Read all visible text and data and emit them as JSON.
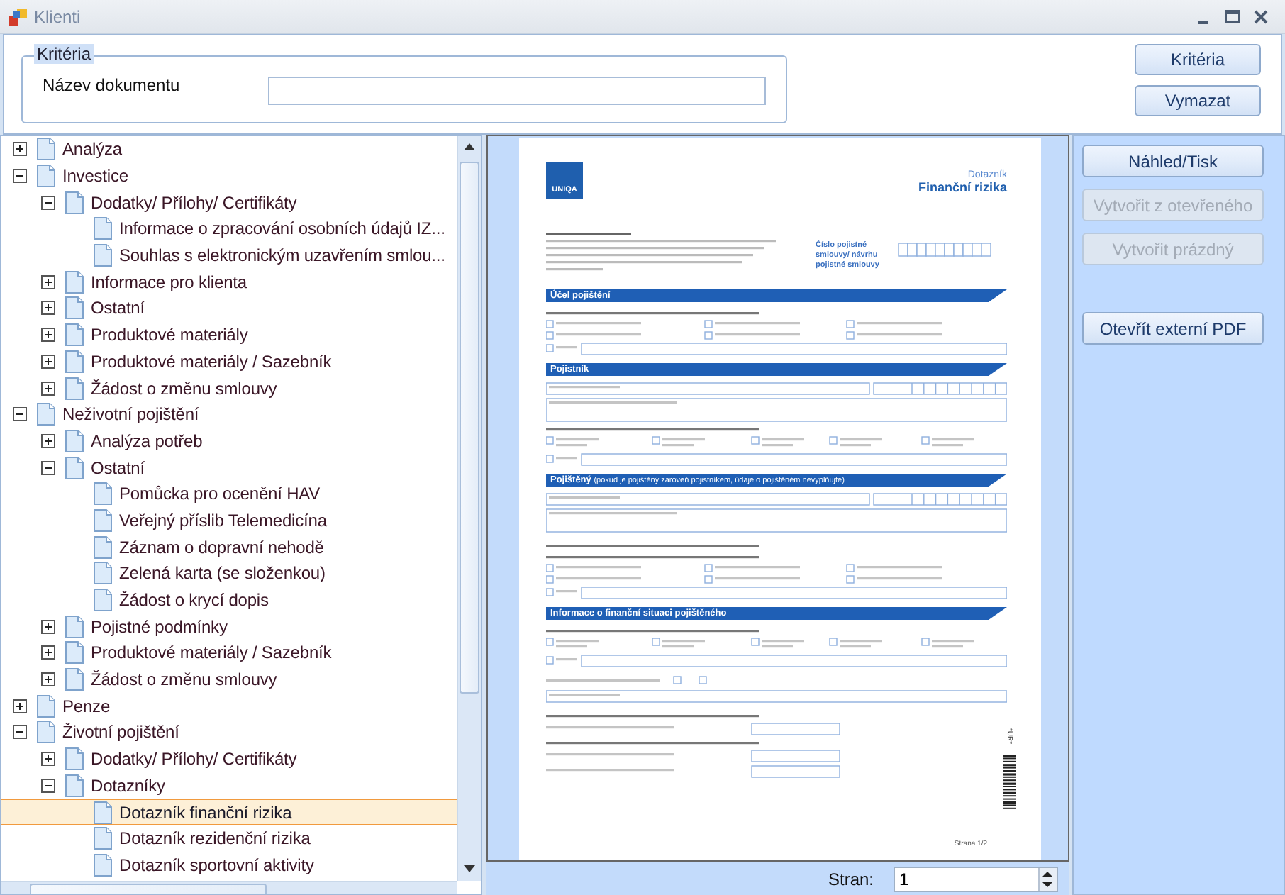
{
  "window": {
    "title": "Klienti"
  },
  "criteria": {
    "group_title": "Kritéria",
    "field_label": "Název dokumentu",
    "buttons": [
      "Kritéria",
      "Vymazat"
    ]
  },
  "tree": {
    "items": [
      {
        "label": "Analýza",
        "expanded": false,
        "selected": false
      },
      {
        "label": "Investice",
        "expanded": true,
        "selected": false,
        "children": [
          {
            "label": "Dodatky/ Přílohy/ Certifikáty",
            "expanded": true,
            "selected": false,
            "children": [
              {
                "label": "Informace o zpracování osobních údajů IZ...",
                "selected": false
              },
              {
                "label": "Souhlas s elektronickým uzavřením smlou...",
                "selected": false
              }
            ]
          },
          {
            "label": "Informace pro klienta",
            "expanded": false,
            "selected": false
          },
          {
            "label": "Ostatní",
            "expanded": false,
            "selected": false
          },
          {
            "label": "Produktové materiály",
            "expanded": false,
            "selected": false
          },
          {
            "label": "Produktové materiály / Sazebník",
            "expanded": false,
            "selected": false
          },
          {
            "label": "Žádost o změnu smlouvy",
            "expanded": false,
            "selected": false
          }
        ]
      },
      {
        "label": "Neživotní pojištění",
        "expanded": true,
        "selected": false,
        "children": [
          {
            "label": "Analýza potřeb",
            "expanded": false,
            "selected": false
          },
          {
            "label": "Ostatní",
            "expanded": true,
            "selected": false,
            "children": [
              {
                "label": "Pomůcka pro ocenění HAV",
                "selected": false
              },
              {
                "label": "Veřejný příslib Telemedicína",
                "selected": false
              },
              {
                "label": "Záznam o dopravní nehodě",
                "selected": false
              },
              {
                "label": "Zelená karta (se složenkou)",
                "selected": false
              },
              {
                "label": "Žádost o krycí dopis",
                "selected": false
              }
            ]
          },
          {
            "label": "Pojistné podmínky",
            "expanded": false,
            "selected": false
          },
          {
            "label": "Produktové materiály / Sazebník",
            "expanded": false,
            "selected": false
          },
          {
            "label": "Žádost o změnu smlouvy",
            "expanded": false,
            "selected": false
          }
        ]
      },
      {
        "label": "Penze",
        "expanded": false,
        "selected": false
      },
      {
        "label": "Životní pojištění",
        "expanded": true,
        "selected": false,
        "children": [
          {
            "label": "Dodatky/ Přílohy/ Certifikáty",
            "expanded": false,
            "selected": false
          },
          {
            "label": "Dotazníky",
            "expanded": true,
            "selected": false,
            "children": [
              {
                "label": "Dotazník finanční rizika",
                "selected": true
              },
              {
                "label": "Dotazník rezidenční rizika",
                "selected": false
              },
              {
                "label": "Dotazník sportovní aktivity",
                "selected": false
              }
            ]
          }
        ]
      }
    ]
  },
  "preview": {
    "document": {
      "logo_text": "UNIQA",
      "kind_title": "Dotazník",
      "title": "Finanční rizika",
      "contract_label": "Číslo pojistné smlouvy/ návrhu pojistné smlouvy",
      "sections": [
        {
          "title": "Účel pojištění"
        },
        {
          "title": "Pojistník"
        },
        {
          "title": "Pojištěný",
          "note": "(pokud je pojištěný zároveň pojistníkem, údaje o pojištěném nevyplňujte)"
        },
        {
          "title": "Informace o finanční situaci pojištěného"
        }
      ],
      "barcode_text": "*UR*",
      "footer": "Strana 1/2"
    },
    "pages_label": "Stran:",
    "pages_value": "1"
  },
  "actions": [
    {
      "label": "Náhled/Tisk",
      "disabled": false
    },
    {
      "label": "Vytvořit z otevřeného",
      "disabled": true
    },
    {
      "label": "Vytvořit prázdný",
      "disabled": true
    },
    {
      "label": "Otevřít externí PDF",
      "disabled": false
    }
  ]
}
